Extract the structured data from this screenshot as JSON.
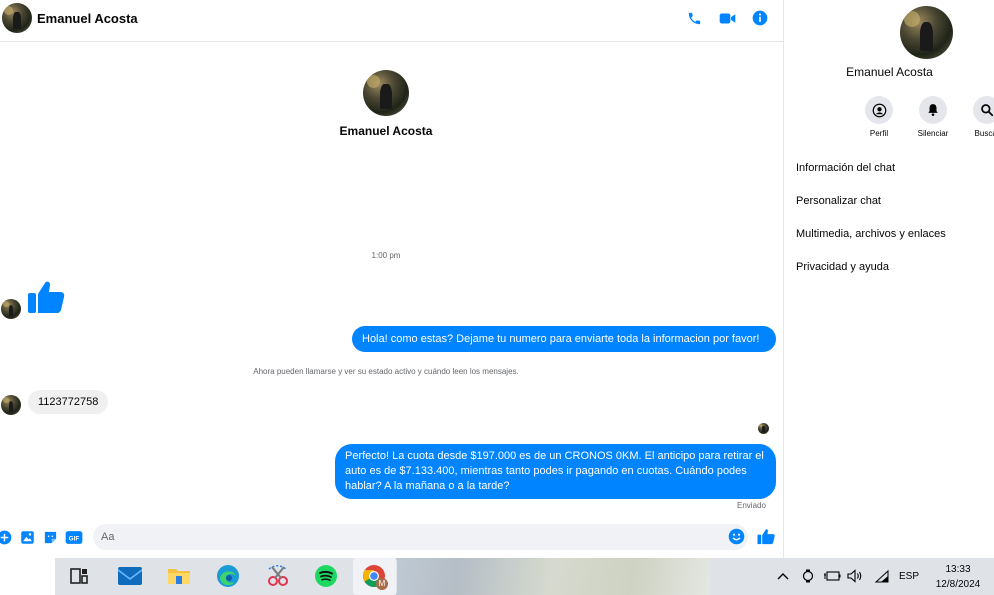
{
  "chat": {
    "contact_name": "Emanuel Acosta",
    "timestamp": "1:00 pm",
    "messages": [
      {
        "dir": "out",
        "text": "Hola! como estas? Dejame tu numero para enviarte toda la informacion por favor!"
      },
      {
        "dir": "system",
        "text": "Ahora pueden llamarse y ver su estado activo y cuándo leen los mensajes."
      },
      {
        "dir": "in",
        "text": "1123772758"
      },
      {
        "dir": "out",
        "text": "Perfecto! La cuota desde $197.000 es de un CRONOS 0KM. El anticipo para retirar el auto es de $7.133.400, mientras tanto podes ir pagando en cuotas. Cuándo podes hablar? A la mañana o a la tarde?"
      }
    ],
    "sent_status": "Enviado",
    "composer_placeholder": "Aa",
    "accent_color": "#0084ff"
  },
  "right_panel": {
    "name": "Emanuel Acosta",
    "actions": [
      {
        "label": "Perfil",
        "icon": "profile-icon"
      },
      {
        "label": "Silenciar",
        "icon": "bell-icon"
      },
      {
        "label": "Buscar",
        "icon": "search-icon"
      }
    ],
    "menu": [
      "Información del chat",
      "Personalizar chat",
      "Multimedia, archivos y enlaces",
      "Privacidad y ayuda"
    ]
  },
  "taskbar": {
    "apps": [
      "task-view-icon",
      "mail-icon",
      "file-explorer-icon",
      "edge-icon",
      "snipping-tool-icon",
      "spotify-icon",
      "chrome-icon"
    ],
    "chrome_profile_letter": "M",
    "language": "ESP",
    "time": "13:33",
    "date": "12/8/2024"
  }
}
